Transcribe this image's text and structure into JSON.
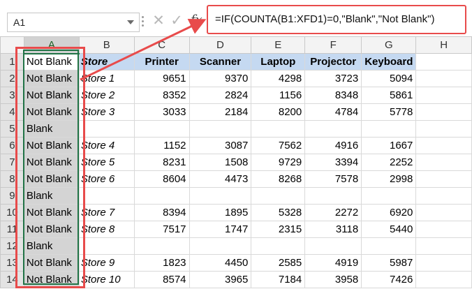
{
  "formula_bar": {
    "name_box": "A1",
    "cancel_glyph": "✕",
    "enter_glyph": "✓",
    "fx_label": "fx",
    "formula": "=IF(COUNTA(B1:XFD1)=0,\"Blank\",\"Not Blank\")"
  },
  "columns": [
    "A",
    "B",
    "C",
    "D",
    "E",
    "F",
    "G",
    "H"
  ],
  "header_row": [
    "Not Blank",
    "Store",
    "Printer",
    "Scanner",
    "Laptop",
    "Projector",
    "Keyboard",
    ""
  ],
  "rows": [
    {
      "num": "1"
    },
    {
      "num": "2",
      "a": "Not Blank",
      "store": "Store 1",
      "values": [
        "9651",
        "9370",
        "4298",
        "3723",
        "5094"
      ]
    },
    {
      "num": "3",
      "a": "Not Blank",
      "store": "Store 2",
      "values": [
        "8352",
        "2824",
        "1156",
        "8348",
        "5861"
      ]
    },
    {
      "num": "4",
      "a": "Not Blank",
      "store": "Store 3",
      "values": [
        "3033",
        "2184",
        "8200",
        "4784",
        "5778"
      ]
    },
    {
      "num": "5",
      "a": "Blank",
      "store": "",
      "values": [
        "",
        "",
        "",
        "",
        ""
      ]
    },
    {
      "num": "6",
      "a": "Not Blank",
      "store": "Store 4",
      "values": [
        "1152",
        "3087",
        "7562",
        "4916",
        "1667"
      ]
    },
    {
      "num": "7",
      "a": "Not Blank",
      "store": "Store 5",
      "values": [
        "8231",
        "1508",
        "9729",
        "3394",
        "2252"
      ]
    },
    {
      "num": "8",
      "a": "Not Blank",
      "store": "Store 6",
      "values": [
        "8604",
        "4473",
        "8268",
        "7578",
        "2998"
      ]
    },
    {
      "num": "9",
      "a": "Blank",
      "store": "",
      "values": [
        "",
        "",
        "",
        "",
        ""
      ]
    },
    {
      "num": "10",
      "a": "Not Blank",
      "store": "Store 7",
      "values": [
        "8394",
        "1895",
        "5328",
        "2272",
        "6920"
      ]
    },
    {
      "num": "11",
      "a": "Not Blank",
      "store": "Store 8",
      "values": [
        "7517",
        "1747",
        "2315",
        "3118",
        "5440"
      ]
    },
    {
      "num": "12",
      "a": "Blank",
      "store": "",
      "values": [
        "",
        "",
        "",
        "",
        ""
      ]
    },
    {
      "num": "13",
      "a": "Not Blank",
      "store": "Store 9",
      "values": [
        "1823",
        "4450",
        "2585",
        "4919",
        "5987"
      ]
    },
    {
      "num": "14",
      "a": "Not Blank",
      "store": "Store 10",
      "values": [
        "8574",
        "3965",
        "7184",
        "3958",
        "7426"
      ]
    }
  ],
  "colors": {
    "header_fill": "#c5d9f1",
    "selection_fill": "#d4d4d4",
    "selection_border": "#217346",
    "annotation": "#e84b4b"
  }
}
